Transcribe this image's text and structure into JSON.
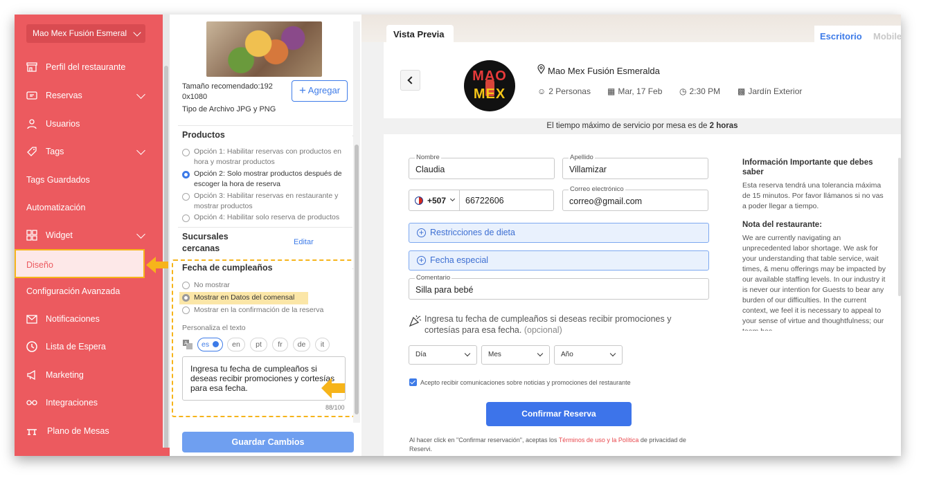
{
  "sidebar": {
    "restaurant_selector": "Mao Mex Fusión Esmeral",
    "items": [
      {
        "label": "Perfil del restaurante"
      },
      {
        "label": "Reservas"
      },
      {
        "label": "Usuarios"
      },
      {
        "label": "Tags"
      },
      {
        "label": "Tags Guardados"
      },
      {
        "label": "Automatización"
      },
      {
        "label": "Widget"
      },
      {
        "label": "Diseño"
      },
      {
        "label": "Configuración Avanzada"
      },
      {
        "label": "Notificaciones"
      },
      {
        "label": "Lista de Espera"
      },
      {
        "label": "Marketing"
      },
      {
        "label": "Integraciones"
      },
      {
        "label": "Plano de Mesas"
      }
    ]
  },
  "settings": {
    "image_size_line1": "Tamaño recomendado:192",
    "image_size_line2": "0x1080",
    "file_type": "Tipo de Archivo JPG y PNG",
    "add_button": "Agregar",
    "productos_title": "Productos",
    "productos_options": [
      "Opción 1: Habilitar reservas con productos en",
      "hora y mostrar productos",
      "Opción 2: Solo mostrar productos después de",
      "escoger la hora de reserva",
      "Opción 3: Habilitar reservas en restaurante y",
      "mostrar productos",
      "Opción 4: Habilitar solo reserva de productos"
    ],
    "sucursales_line1": "Sucursales",
    "sucursales_line2": "cercanas",
    "edit_link": "Editar",
    "birthday_title": "Fecha de cumpleaños",
    "birthday_options": [
      "No mostrar",
      "Mostrar en Datos del comensal",
      "Mostrar en la confirmación de la reserva"
    ],
    "personaliza": "Personaliza el texto",
    "languages": [
      "es",
      "en",
      "pt",
      "fr",
      "de",
      "it"
    ],
    "textarea": "Ingresa tu fecha de cumpleaños si deseas recibir promociones y cortesías para esa fecha.",
    "counter": "88/100",
    "save_button": "Guardar Cambios"
  },
  "preview": {
    "tab_label": "Vista Previa",
    "mode_desktop": "Escritorio",
    "mode_mobile": "Mobile",
    "logo_top": "MAO",
    "logo_bottom": "MEX",
    "restaurant_name": "Mao Mex Fusión Esmeralda",
    "people": "2 Personas",
    "date": "Mar, 17 Feb",
    "time": "2:30 PM",
    "area": "Jardín Exterior",
    "service_prefix": "El tiempo máximo de servicio por mesa es de ",
    "service_bold": "2 horas",
    "nombre_label": "Nombre",
    "nombre_value": "Claudia",
    "apellido_label": "Apellido",
    "apellido_value": "Villamizar",
    "phone_code": "+507",
    "phone_value": "66722606",
    "email_label": "Correo electrónico",
    "email_value": "correo@gmail.com",
    "dietary": "Restricciones de dieta",
    "special_date": "Fecha especial",
    "comment_label": "Comentario",
    "comment_value": "Silla para bebé",
    "birthday_text": "Ingresa tu fecha de cumpleaños si deseas recibir promociones y cortesías para esa fecha.",
    "optional": "(opcional)",
    "day": "Día",
    "month": "Mes",
    "year": "Año",
    "consent": "Acepto recibir comunicaciones sobre noticias y promociones del restaurante",
    "confirm_button": "Confirmar Reserva",
    "terms_prefix": "Al hacer click en \"Confirmar reservación\", aceptas los ",
    "terms_link": "Términos de uso y la Política",
    "terms_suffix": " de privacidad de Reservi.",
    "info_title": "Información Importante que debes saber",
    "info_text": "Esta reserva tendrá una tolerancia máxima de 15 minutos. Por favor llámanos si no vas a poder llegar a tiempo.",
    "note_title": "Nota del restaurante:",
    "note_text": "We are currently navigating an unprecedented labor shortage. We ask for your understanding that table service, wait times, & menu offerings may be impacted by our available staffing levels. In our industry it is never our intention for Guests to bear any burden of our difficulties. In the current context, we feel it is necessary to appeal to your sense of virtue and thoughtfulness; our team has"
  },
  "colors": {
    "sidebar": "#ec5a5f",
    "accent_blue": "#3d7be8",
    "highlight_yellow": "#f6b41a"
  }
}
